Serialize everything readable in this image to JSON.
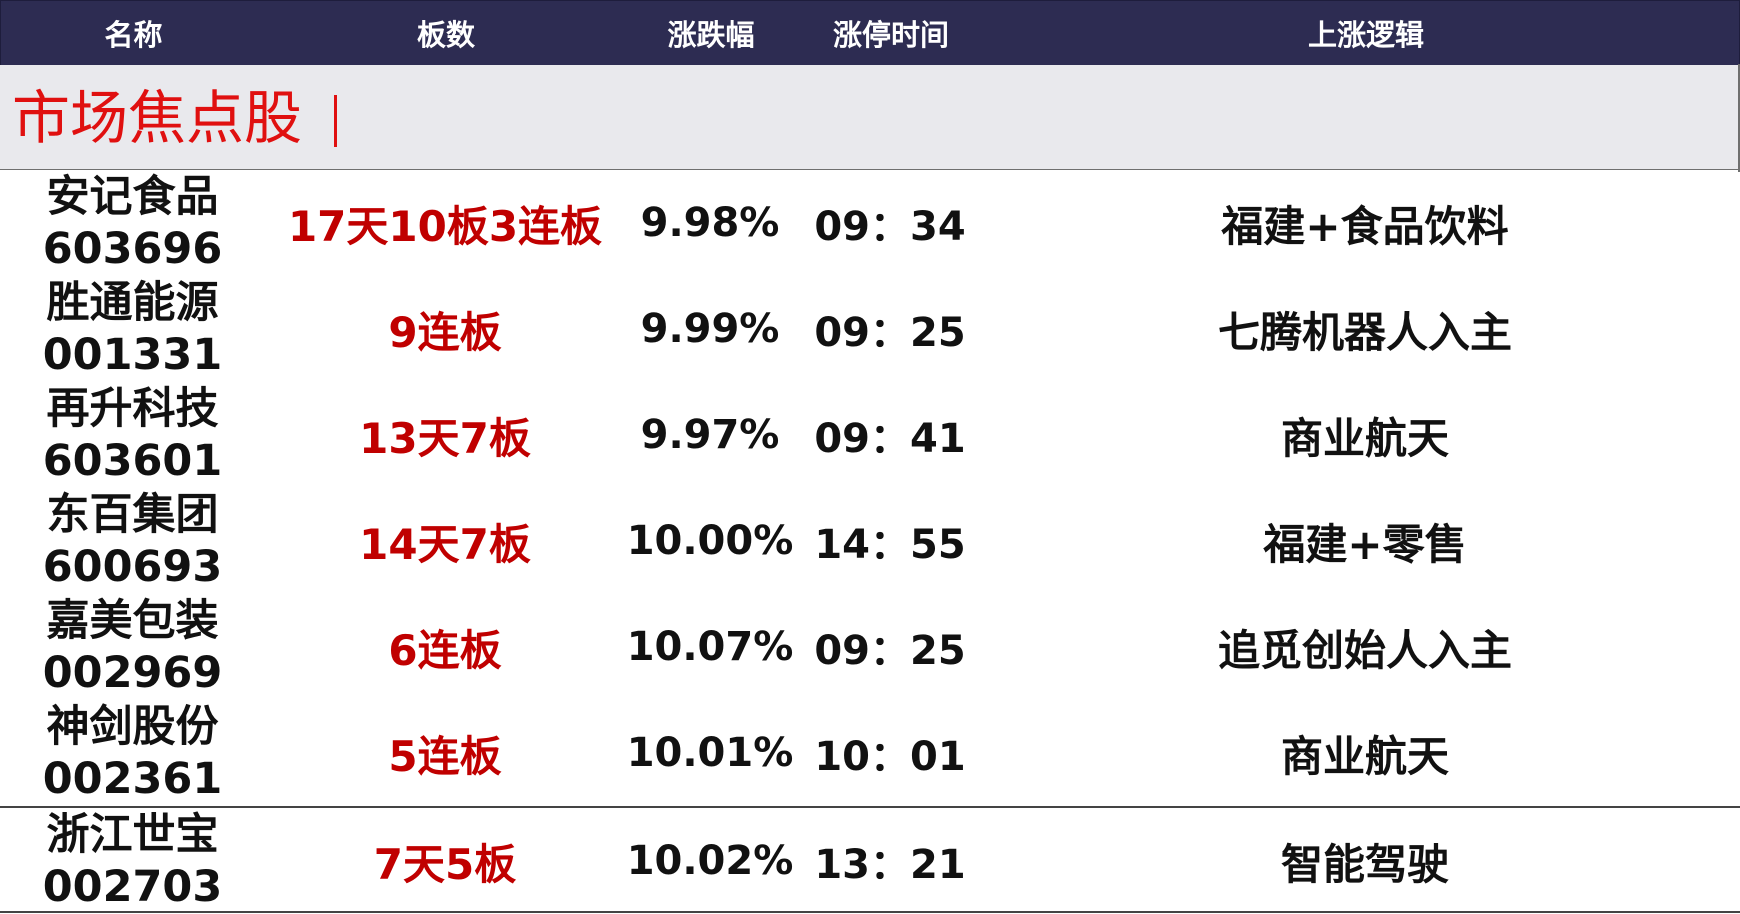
{
  "header": {
    "name": "名称",
    "boards": "板数",
    "change": "涨跌幅",
    "limit_time": "涨停时间",
    "logic": "上涨逻辑"
  },
  "section": {
    "title": "市场焦点股"
  },
  "colors": {
    "header_bg": "#2d2c52",
    "section_bg": "#e9e9ed",
    "title_red": "#e01010",
    "boards_red": "#c00000"
  },
  "rows": [
    {
      "name": "安记食品",
      "code": "603696",
      "boards": "17天10板3连板",
      "change": "9.98%",
      "time": "09：34",
      "logic": "福建+食品饮料"
    },
    {
      "name": "胜通能源",
      "code": "001331",
      "boards": "9连板",
      "change": "9.99%",
      "time": "09：25",
      "logic": "七腾机器人入主"
    },
    {
      "name": "再升科技",
      "code": "603601",
      "boards": "13天7板",
      "change": "9.97%",
      "time": "09：41",
      "logic": "商业航天"
    },
    {
      "name": "东百集团",
      "code": "600693",
      "boards": "14天7板",
      "change": "10.00%",
      "time": "14：55",
      "logic": "福建+零售"
    },
    {
      "name": "嘉美包装",
      "code": "002969",
      "boards": "6连板",
      "change": "10.07%",
      "time": "09：25",
      "logic": "追觅创始人入主"
    },
    {
      "name": "神剑股份",
      "code": "002361",
      "boards": "5连板",
      "change": "10.01%",
      "time": "10：01",
      "logic": "商业航天"
    },
    {
      "name": "浙江世宝",
      "code": "002703",
      "boards": "7天5板",
      "change": "10.02%",
      "time": "13：21",
      "logic": "智能驾驶"
    }
  ]
}
